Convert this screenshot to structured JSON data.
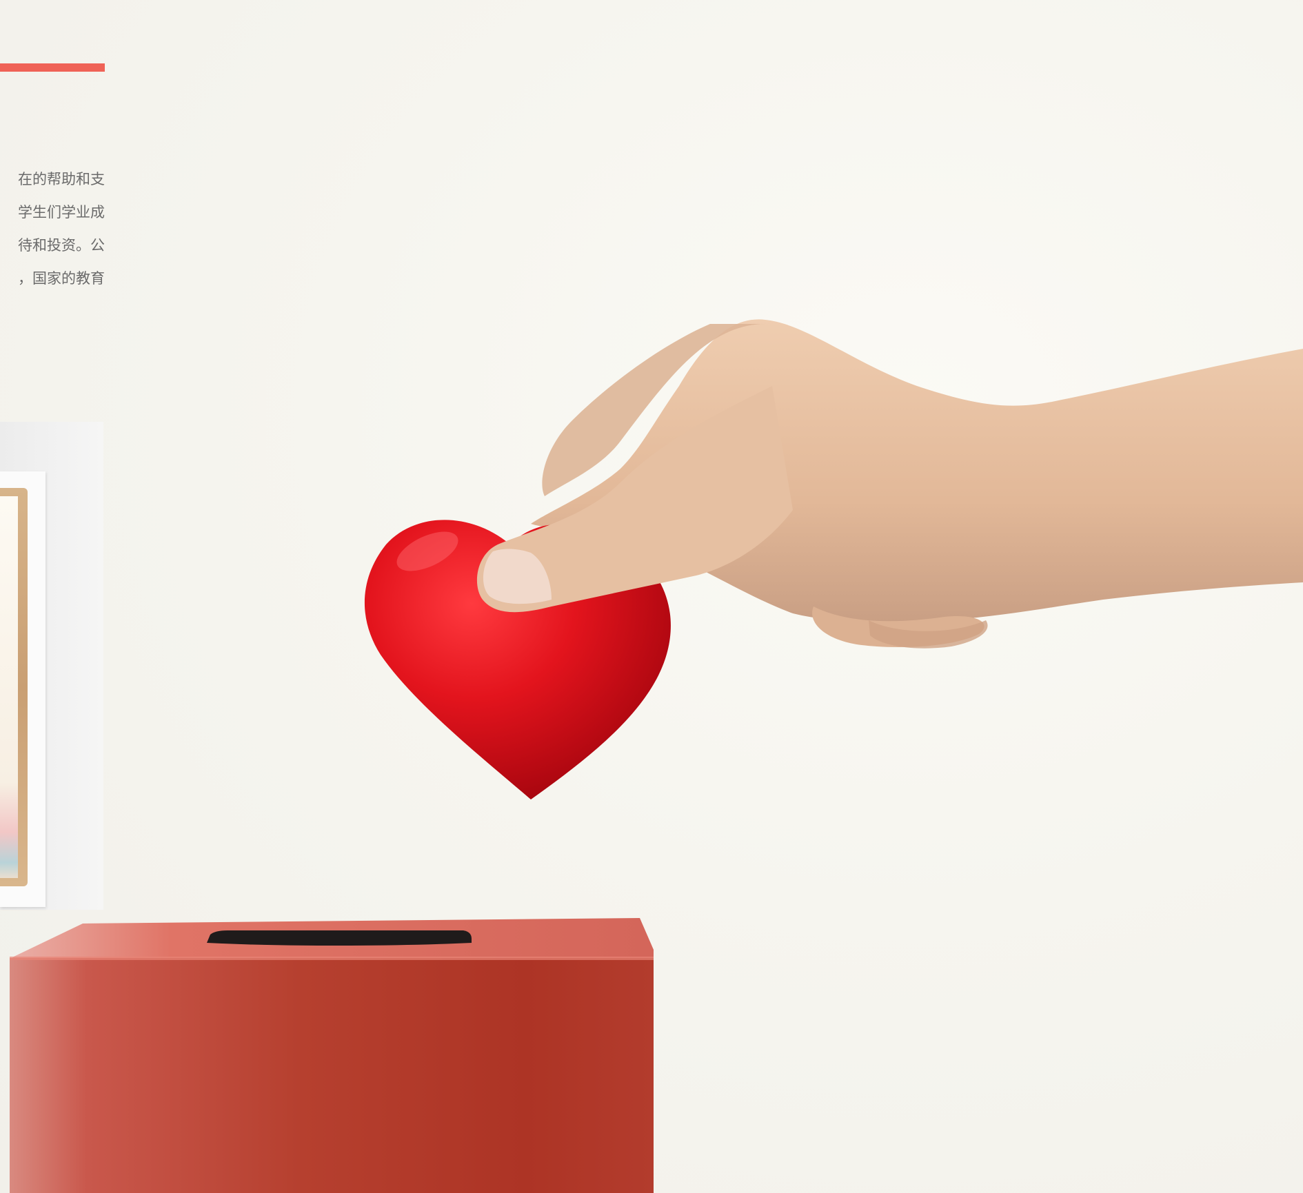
{
  "colors": {
    "accent": "#ef6256",
    "heart": "#e3141d",
    "box": "#b6402f",
    "skin": "#e7c1a3"
  },
  "paragraph": {
    "lines": [
      "在的帮助和支",
      "学生们学业成",
      "待和投资。公",
      "，国家的教育"
    ]
  }
}
